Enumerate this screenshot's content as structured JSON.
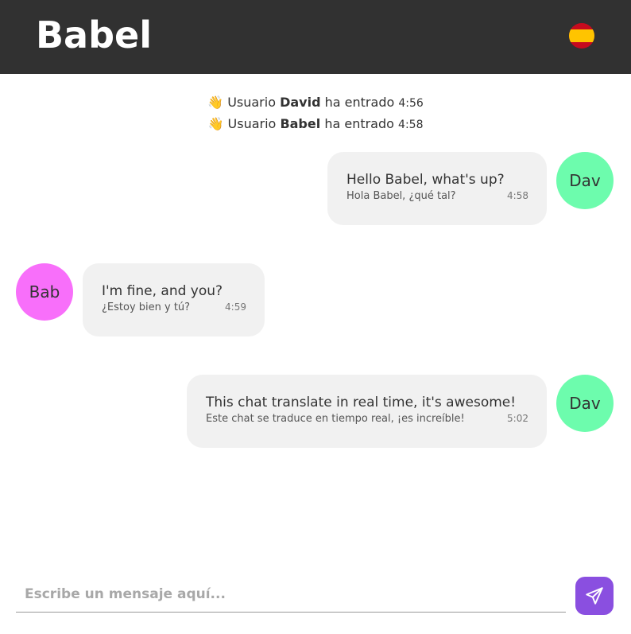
{
  "header": {
    "title": "Babel",
    "language_flag": "spain-flag-icon"
  },
  "events": [
    {
      "icon": "👋",
      "prefix": "Usuario",
      "user": "David",
      "suffix": "ha entrado",
      "time": "4:56"
    },
    {
      "icon": "👋",
      "prefix": "Usuario",
      "user": "Babel",
      "suffix": "ha entrado",
      "time": "4:58"
    }
  ],
  "messages": [
    {
      "side": "right",
      "avatar": "Dav",
      "avatar_color": "#6dfcad",
      "text": "Hello Babel, what's up?",
      "translation": "Hola Babel, ¿qué tal?",
      "time": "4:58"
    },
    {
      "side": "left",
      "avatar": "Bab",
      "avatar_color": "#f86ffa",
      "text": "I'm fine, and you?",
      "translation": "¿Estoy bien y tú?",
      "time": "4:59"
    },
    {
      "side": "right",
      "avatar": "Dav",
      "avatar_color": "#6dfcad",
      "text": "This chat translate in real time, it's awesome!",
      "translation": "Este chat se traduce en tiempo real, ¡es increíble!",
      "time": "5:02"
    }
  ],
  "composer": {
    "placeholder": "Escribe un mensaje aquí...",
    "value": "",
    "send_icon": "paper-plane-icon",
    "accent": "#8a4fe0"
  },
  "colors": {
    "header_bg": "#313131",
    "bubble_bg": "#f1f1f1"
  }
}
